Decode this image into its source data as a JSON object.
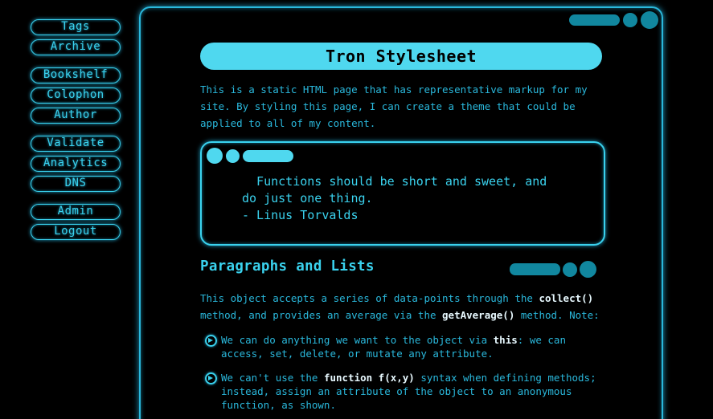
{
  "nav": {
    "groups": [
      [
        "Tags",
        "Archive"
      ],
      [
        "Bookshelf",
        "Colophon",
        "Author"
      ],
      [
        "Validate",
        "Analytics",
        "DNS"
      ],
      [
        "Admin",
        "Logout"
      ]
    ]
  },
  "page": {
    "title": "Tron Stylesheet",
    "intro": "This is a static HTML page that has representative markup for my site. By styling this page, I can create a theme that could be applied to all of my content."
  },
  "quote": {
    "text": "  Functions should be short and sweet, and\ndo just one thing.\n- Linus Torvalds"
  },
  "section": {
    "heading": "Paragraphs and Lists",
    "para_before_collect": "This object accepts a series of data-points through the ",
    "collect_code": "collect()",
    "para_middle": " method, and provides an average via the ",
    "getaverage_code": "getAverage()",
    "para_after": " method. Note:"
  },
  "list": [
    {
      "before": "We can do anything we want to the object via ",
      "code": "this",
      "after": ": we can access, set, delete, or mutate any attribute."
    },
    {
      "before": "We can't use the ",
      "code": "function f(x,y)",
      "after": " syntax when defining methods; instead, assign an attribute of the object to an anonymous function, as shown."
    }
  ],
  "colors": {
    "accent": "#3ad2ee",
    "dim": "#11879f",
    "text": "#2ab8dc",
    "background": "#000000"
  }
}
